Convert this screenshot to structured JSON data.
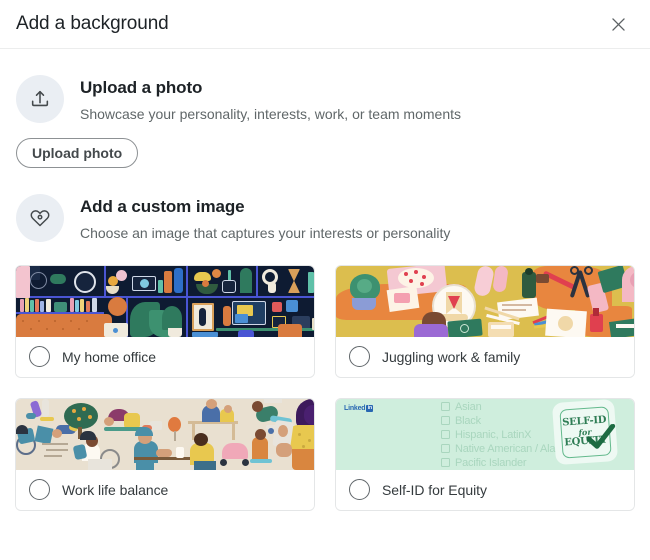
{
  "header": {
    "title": "Add a background",
    "close_label": "Dismiss",
    "close_icon": "close-icon"
  },
  "upload_section": {
    "icon": "upload-icon",
    "title": "Upload a photo",
    "subtitle": "Showcase your personality, interests, work, or team moments",
    "button_label": "Upload photo"
  },
  "custom_section": {
    "icon": "heart-icon",
    "title": "Add a custom image",
    "subtitle": "Choose an image that captures your interests or personality"
  },
  "cards": [
    {
      "label": "My home office",
      "illustration": "home-office",
      "selected": false
    },
    {
      "label": "Juggling work & family",
      "illustration": "juggling-work-family",
      "selected": false
    },
    {
      "label": "Work life balance",
      "illustration": "work-life-balance",
      "selected": false
    },
    {
      "label": "Self-ID for Equity",
      "illustration": "self-id-for-equity",
      "selected": false
    }
  ],
  "self_id_art": {
    "brand": "Linked",
    "brand_mark": "in",
    "options": [
      "Asian",
      "Black",
      "Hispanic, LatinX",
      "Native American / Alaska Native",
      "Pacific Islander"
    ],
    "stamp_line1": "SELF-ID",
    "stamp_line2": "for",
    "stamp_line3": "EQUITY"
  },
  "colors": {
    "text_primary": "#1d2226",
    "text_secondary": "#606769",
    "border": "#e4e6e7",
    "icon_circle_bg": "#eaeef3",
    "linkedin_blue": "#2867b2",
    "office_bg": "#0e1b32",
    "juggling_bg": "#dcbe4e",
    "worklife_bg": "#e9e0d0",
    "selfid_bg": "#cfeedd"
  }
}
